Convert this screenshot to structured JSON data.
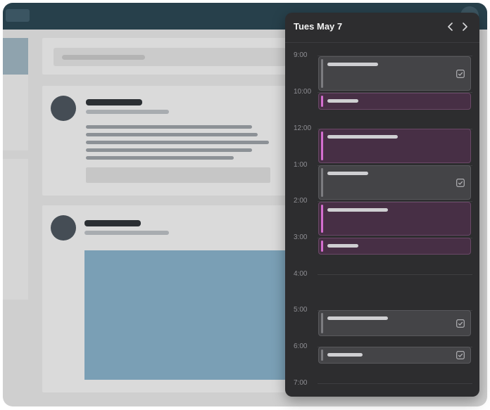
{
  "calendar": {
    "title": "Tues May 7",
    "prev_icon": "chevron-left-icon",
    "next_icon": "chevron-right-icon",
    "hours": [
      "9:00",
      "10:00",
      "12:00",
      "1:00",
      "2:00",
      "3:00",
      "4:00",
      "5:00",
      "6:00",
      "7:00"
    ],
    "event_kinds": [
      "task",
      "meeting",
      "meeting",
      "task",
      "meeting",
      "meeting",
      "task",
      "task"
    ],
    "completed_icon": "checkbox-checked-icon"
  },
  "colors": {
    "panel_bg": "#2d2d2f",
    "meeting_accent": "#d56ed0",
    "task_accent": "#7c7c80",
    "topbar": "#27404b",
    "image_placeholder": "#7a9fb5"
  }
}
